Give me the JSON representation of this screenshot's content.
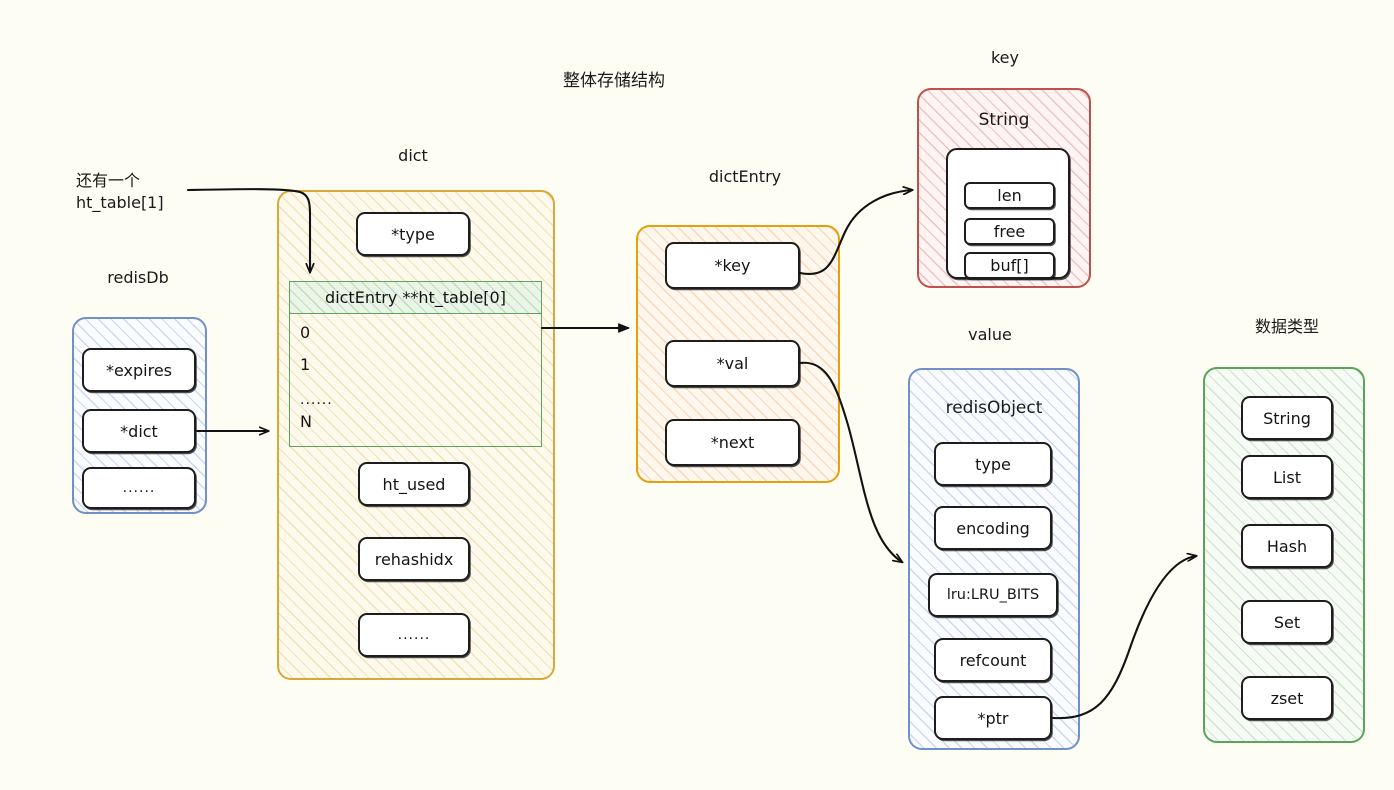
{
  "title": "整体存储结构",
  "colors": {
    "background": "#fdfdf3",
    "dict_border": "#d7a93a",
    "dict_entry_border": "#e5a00d",
    "redisdb_border": "#7090c8",
    "string_border": "#c0504a",
    "redisobject_border": "#7090c8",
    "datatypes_border": "#5ca35c",
    "httable_border": "#5ca35c",
    "field_border": "#1d1d1d",
    "text": "#1a1a1a"
  },
  "annotations": {
    "ht_table_note": "还有一个\nht_table[1]"
  },
  "groups": {
    "redisDb": {
      "label": "redisDb",
      "fields": [
        "*expires",
        "*dict",
        "......"
      ]
    },
    "dict": {
      "label": "dict",
      "fields_top": [
        "*type"
      ],
      "ht_table": {
        "header": "dictEntry **ht_table[0]",
        "rows": [
          "0",
          "1",
          "......",
          "N"
        ]
      },
      "fields_bottom": [
        "ht_used",
        "rehashidx",
        "......"
      ]
    },
    "dictEntry": {
      "label": "dictEntry",
      "fields": [
        "*key",
        "*val",
        "*next"
      ]
    },
    "key": {
      "label": "key",
      "inner_title": "String",
      "fields": [
        "len",
        "free",
        "buf[]"
      ]
    },
    "value": {
      "label": "value",
      "inner_title": "redisObject",
      "fields": [
        "type",
        "encoding",
        "lru:LRU_BITS",
        "refcount",
        "*ptr"
      ]
    },
    "dataTypes": {
      "label": "数据类型",
      "fields": [
        "String",
        "List",
        "Hash",
        "Set",
        "zset"
      ]
    }
  },
  "edges": [
    {
      "name": "ht-table-note-to-ht-table",
      "from": "note",
      "to": "dict.ht_table"
    },
    {
      "name": "redisdb-dict-to-dict",
      "from": "redisDb.*dict",
      "to": "dict"
    },
    {
      "name": "ht-table-to-dictentry",
      "from": "dict.ht_table",
      "to": "dictEntry"
    },
    {
      "name": "key-to-string",
      "from": "dictEntry.*key",
      "to": "key.String"
    },
    {
      "name": "val-to-redisobject",
      "from": "dictEntry.*val",
      "to": "value.redisObject"
    },
    {
      "name": "ptr-to-datatypes",
      "from": "value.*ptr",
      "to": "dataTypes"
    }
  ]
}
